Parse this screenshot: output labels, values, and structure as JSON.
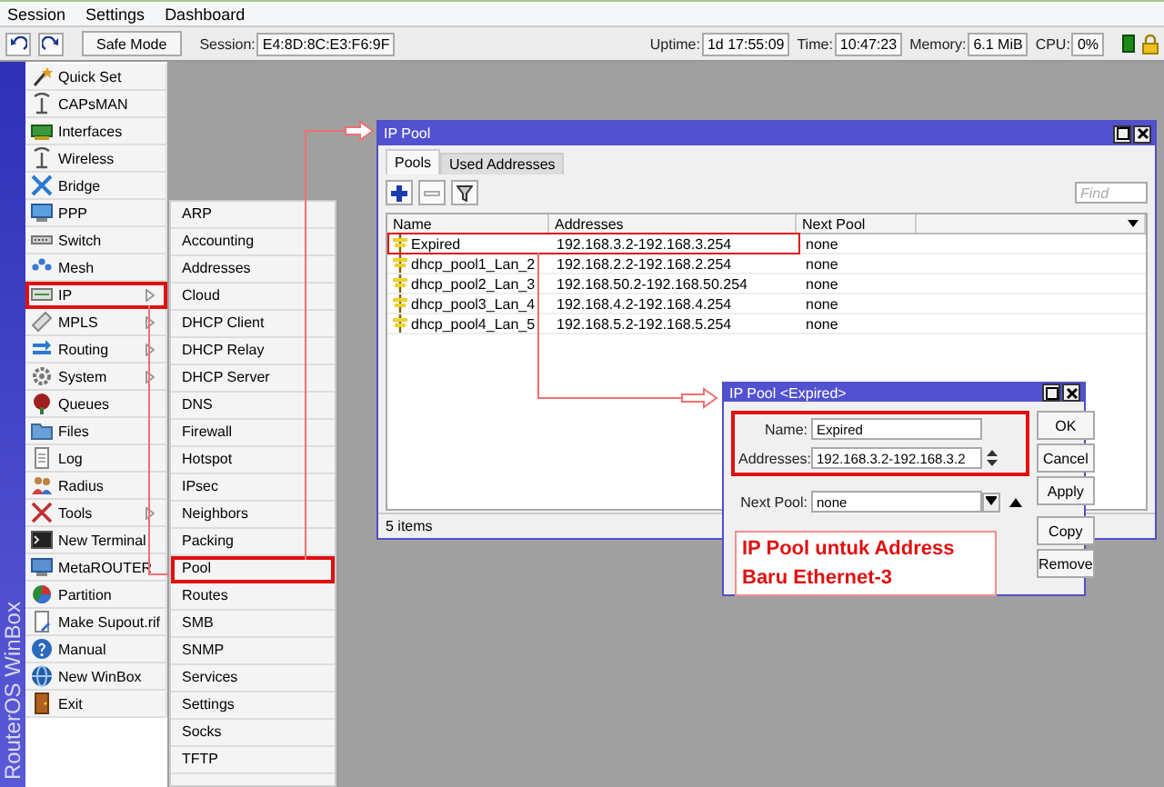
{
  "menubar": [
    "Session",
    "Settings",
    "Dashboard"
  ],
  "toolbar": {
    "safe_mode": "Safe Mode",
    "session_label": "Session:",
    "session": "E4:8D:8C:E3:F6:9F",
    "stats": [
      {
        "label": "Uptime:",
        "value": "1d 17:55:09"
      },
      {
        "label": "Time:",
        "value": "10:47:23"
      },
      {
        "label": "Memory:",
        "value": "6.1 MiB"
      },
      {
        "label": "CPU:",
        "value": "0%"
      }
    ]
  },
  "brand": "RouterOS WinBox",
  "sidebar": [
    {
      "label": "Quick Set",
      "submenu": false,
      "highlighted": false
    },
    {
      "label": "CAPsMAN",
      "submenu": false,
      "highlighted": false
    },
    {
      "label": "Interfaces",
      "submenu": false,
      "highlighted": false
    },
    {
      "label": "Wireless",
      "submenu": false,
      "highlighted": false
    },
    {
      "label": "Bridge",
      "submenu": false,
      "highlighted": false
    },
    {
      "label": "PPP",
      "submenu": false,
      "highlighted": false
    },
    {
      "label": "Switch",
      "submenu": false,
      "highlighted": false
    },
    {
      "label": "Mesh",
      "submenu": false,
      "highlighted": false
    },
    {
      "label": "IP",
      "submenu": true,
      "highlighted": true
    },
    {
      "label": "MPLS",
      "submenu": true,
      "highlighted": false
    },
    {
      "label": "Routing",
      "submenu": true,
      "highlighted": false
    },
    {
      "label": "System",
      "submenu": true,
      "highlighted": false
    },
    {
      "label": "Queues",
      "submenu": false,
      "highlighted": false
    },
    {
      "label": "Files",
      "submenu": false,
      "highlighted": false
    },
    {
      "label": "Log",
      "submenu": false,
      "highlighted": false
    },
    {
      "label": "Radius",
      "submenu": false,
      "highlighted": false
    },
    {
      "label": "Tools",
      "submenu": true,
      "highlighted": false
    },
    {
      "label": "New Terminal",
      "submenu": false,
      "highlighted": false
    },
    {
      "label": "MetaROUTER",
      "submenu": false,
      "highlighted": false
    },
    {
      "label": "Partition",
      "submenu": false,
      "highlighted": false
    },
    {
      "label": "Make Supout.rif",
      "submenu": false,
      "highlighted": false
    },
    {
      "label": "Manual",
      "submenu": false,
      "highlighted": false
    },
    {
      "label": "New WinBox",
      "submenu": false,
      "highlighted": false
    },
    {
      "label": "Exit",
      "submenu": false,
      "highlighted": false
    }
  ],
  "submenu": [
    {
      "label": "ARP",
      "highlighted": false
    },
    {
      "label": "Accounting",
      "highlighted": false
    },
    {
      "label": "Addresses",
      "highlighted": false
    },
    {
      "label": "Cloud",
      "highlighted": false
    },
    {
      "label": "DHCP Client",
      "highlighted": false
    },
    {
      "label": "DHCP Relay",
      "highlighted": false
    },
    {
      "label": "DHCP Server",
      "highlighted": false
    },
    {
      "label": "DNS",
      "highlighted": false
    },
    {
      "label": "Firewall",
      "highlighted": false
    },
    {
      "label": "Hotspot",
      "highlighted": false
    },
    {
      "label": "IPsec",
      "highlighted": false
    },
    {
      "label": "Neighbors",
      "highlighted": false
    },
    {
      "label": "Packing",
      "highlighted": false
    },
    {
      "label": "Pool",
      "highlighted": true
    },
    {
      "label": "Routes",
      "highlighted": false
    },
    {
      "label": "SMB",
      "highlighted": false
    },
    {
      "label": "SNMP",
      "highlighted": false
    },
    {
      "label": "Services",
      "highlighted": false
    },
    {
      "label": "Settings",
      "highlighted": false
    },
    {
      "label": "Socks",
      "highlighted": false
    },
    {
      "label": "TFTP",
      "highlighted": false
    }
  ],
  "pool_window": {
    "title": "IP Pool",
    "tabs": [
      {
        "label": "Pools",
        "selected": true
      },
      {
        "label": "Used Addresses",
        "selected": false
      }
    ],
    "find_placeholder": "Find",
    "columns": [
      "Name",
      "Addresses",
      "Next Pool"
    ],
    "rows": [
      {
        "name": "Expired",
        "addresses": "192.168.3.2-192.168.3.254",
        "next_pool": "none",
        "highlighted": true
      },
      {
        "name": "dhcp_pool1_Lan_2",
        "addresses": "192.168.2.2-192.168.2.254",
        "next_pool": "none",
        "highlighted": false
      },
      {
        "name": "dhcp_pool2_Lan_3",
        "addresses": "192.168.50.2-192.168.50.254",
        "next_pool": "none",
        "highlighted": false
      },
      {
        "name": "dhcp_pool3_Lan_4",
        "addresses": "192.168.4.2-192.168.4.254",
        "next_pool": "none",
        "highlighted": false
      },
      {
        "name": "dhcp_pool4_Lan_5",
        "addresses": "192.168.5.2-192.168.5.254",
        "next_pool": "none",
        "highlighted": false
      }
    ],
    "status": "5 items"
  },
  "edit_dialog": {
    "title": "IP Pool <Expired>",
    "fields": [
      {
        "label": "Name:",
        "value": "Expired",
        "kind": "text",
        "highlighted": true
      },
      {
        "label": "Addresses:",
        "value": "192.168.3.2-192.168.3.2",
        "kind": "spin",
        "highlighted": true
      },
      {
        "label": "Next Pool:",
        "value": "none",
        "kind": "dropdown",
        "highlighted": false
      }
    ],
    "buttons": [
      "OK",
      "Cancel",
      "Apply",
      "Copy",
      "Remove"
    ],
    "annotation": "IP Pool untuk Address Baru Ethernet-3"
  }
}
